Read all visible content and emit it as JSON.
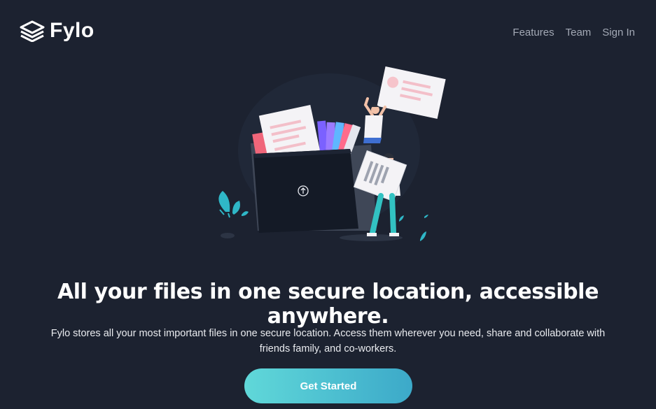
{
  "brand": {
    "name": "Fylo"
  },
  "nav": {
    "items": [
      {
        "label": "Features"
      },
      {
        "label": "Team"
      },
      {
        "label": "Sign In"
      }
    ]
  },
  "hero": {
    "headline": "All your files in one secure location, accessible anywhere.",
    "description": "Fylo stores all your most important files in one secure location. Access them wherever you need, share and collaborate with friends family, and co-workers.",
    "cta_label": "Get Started"
  },
  "colors": {
    "background": "#1c2230",
    "cta_gradient_start": "#60d8d9",
    "cta_gradient_end": "#3ca9c9",
    "nav_text": "#a3a9b5"
  },
  "icons": {
    "logo": "stacked-layers-icon",
    "upload": "upload-arrow-icon"
  }
}
